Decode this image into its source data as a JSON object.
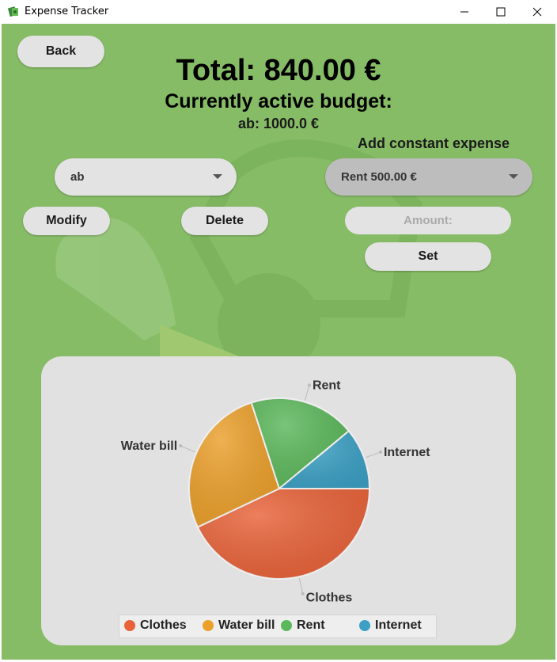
{
  "window": {
    "title": "Expense Tracker",
    "minimize_icon": "minimize-icon",
    "maximize_icon": "maximize-icon",
    "close_icon": "close-icon"
  },
  "header": {
    "back_label": "Back",
    "total": "Total: 840.00 €",
    "budget_heading": "Currently active budget:",
    "budget_value": "ab: 1000.0 €"
  },
  "budget": {
    "selected": "ab",
    "modify_label": "Modify",
    "delete_label": "Delete"
  },
  "constant_expense": {
    "label": "Add constant expense",
    "selected": "Rent 500.00 €",
    "amount_placeholder": "Amount:",
    "amount_value": "",
    "set_label": "Set"
  },
  "colors": {
    "background": "#86bc66",
    "clothes": "#e8633a",
    "water_bill": "#eba02c",
    "rent": "#5cb85c",
    "internet": "#3ca0c4"
  },
  "chart_data": {
    "type": "pie",
    "title": "",
    "slices": [
      {
        "label": "Clothes",
        "value": 0.43
      },
      {
        "label": "Water bill",
        "value": 0.27
      },
      {
        "label": "Rent",
        "value": 0.19
      },
      {
        "label": "Internet",
        "value": 0.11
      }
    ],
    "legend": [
      "Clothes",
      "Water bill",
      "Rent",
      "Internet"
    ],
    "legend_placement": "bottom"
  }
}
